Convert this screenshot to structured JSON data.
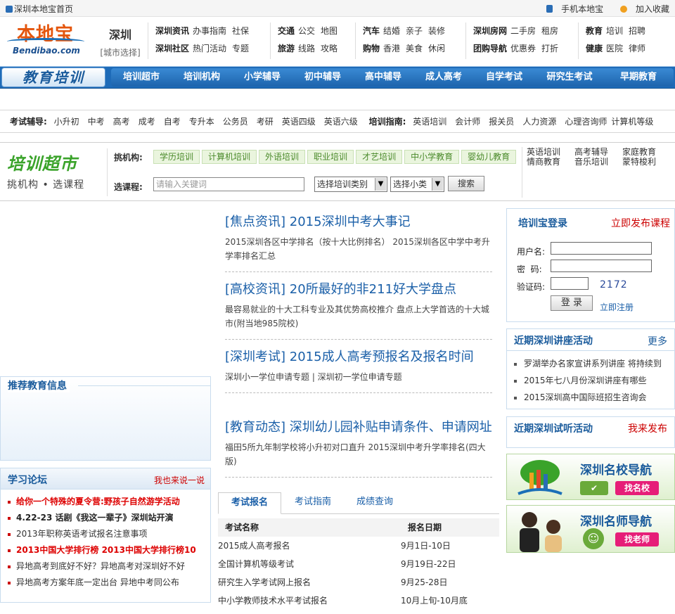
{
  "topbar": {
    "home": "深圳本地宝首页",
    "mobile": "手机本地宝",
    "favorite": "加入收藏"
  },
  "logo": {
    "cn": "本地宝",
    "en": "Bendibao.com"
  },
  "city": {
    "name": "深圳",
    "select": "[城市选择]"
  },
  "header_nav": [
    {
      "rows": [
        [
          "深圳资讯",
          "办事指南",
          "社保"
        ],
        [
          "深圳社区",
          "热门活动",
          "专题"
        ]
      ]
    },
    {
      "rows": [
        [
          "交通",
          "公交",
          "地图"
        ],
        [
          "旅游",
          "线路",
          "攻略"
        ]
      ]
    },
    {
      "rows": [
        [
          "汽车",
          "结婚",
          "亲子",
          "装修"
        ],
        [
          "购物",
          "香港",
          "美食",
          "休闲"
        ]
      ]
    },
    {
      "rows": [
        [
          "深圳房网",
          "二手房",
          "租房"
        ],
        [
          "团购导航",
          "优惠券",
          "打折"
        ]
      ]
    },
    {
      "rows": [
        [
          "教育",
          "培训",
          "招聘"
        ],
        [
          "健康",
          "医院",
          "律师"
        ]
      ]
    }
  ],
  "edu": {
    "title": "教育培训",
    "nav": [
      "培训超市",
      "培训机构",
      "小学辅导",
      "初中辅导",
      "高中辅导",
      "成人高考",
      "自学考试",
      "研究生考试",
      "早期教育"
    ]
  },
  "exam_row": {
    "label1": "考试辅导:",
    "items1": [
      "小升初",
      "中考",
      "高考",
      "成考",
      "自考",
      "专升本",
      "公务员",
      "考研",
      "英语四级",
      "英语六级"
    ],
    "label2": "培训指南:",
    "items2": [
      "英语培训",
      "会计师",
      "报关员",
      "人力资源",
      "心理咨询师",
      "计算机等级"
    ]
  },
  "market": {
    "logo_title": "培训超市",
    "logo_sub": "挑机构 • 选课程",
    "label_org": "挑机构:",
    "tags": [
      "学历培训",
      "计算机培训",
      "外语培训",
      "职业培训",
      "才艺培训",
      "中小学教育",
      "婴幼儿教育"
    ],
    "label_course": "选课程:",
    "input_placeholder": "请输入关键词",
    "select1": "选择培训类别",
    "select2": "选择小类",
    "search": "搜索",
    "links": [
      [
        "英语培训",
        "高考辅导",
        "家庭教育"
      ],
      [
        "情商教育",
        "音乐培训",
        "蒙特梭利"
      ]
    ]
  },
  "recommend": {
    "title": "推荐教育信息"
  },
  "forum": {
    "title": "学习论坛",
    "more": "我也来说一说",
    "items": [
      {
        "text": "给你一个特殊的夏令营:野孩子自然游学活动",
        "style": "red"
      },
      {
        "text": "4.22-23 话剧《我这一辈子》深圳站开演",
        "style": "bold"
      },
      {
        "text": "2013年职称英语考试报名注意事项",
        "style": ""
      },
      {
        "text": "2013中国大学排行榜  2013中国大学排行榜10",
        "style": "red"
      },
      {
        "text": "异地高考到底好不好？异地高考对深圳好不好",
        "style": ""
      },
      {
        "text": "异地高考方案年底一定出台  异地中考同公布",
        "style": ""
      }
    ]
  },
  "news": [
    {
      "title": "[焦点资讯] 2015深圳中考大事记",
      "desc": "2015深圳各区中学排名（按十大比例排名） 2015深圳各区中学中考升学率排名汇总"
    },
    {
      "title": "[高校资讯] 20所最好的非211好大学盘点",
      "desc": "最容易就业的十大工科专业及其优势高校推介  盘点上大学首选的十大城市(附当地985院校)"
    },
    {
      "title": "[深圳考试] 2015成人高考预报名及报名时间",
      "desc": "深圳小一学位申请专题 | 深圳初一学位申请专题"
    },
    {
      "title": "[教育动态] 深圳幼儿园补贴申请条件、申请网址",
      "desc": "福田5所九年制学校将小升初对口直升  2015深圳中考升学率排名(四大版)"
    }
  ],
  "exam_tabs": [
    "考试报名",
    "考试指南",
    "成绩查询"
  ],
  "exam_table": {
    "headers": [
      "考试名称",
      "报名日期"
    ],
    "rows": [
      [
        "2015成人高考报名",
        "9月1日-10日"
      ],
      [
        "全国计算机等级考试",
        "9月19日-22日"
      ],
      [
        "研究生入学考试网上报名",
        "9月25-28日"
      ],
      [
        "中小学教师技术水平考试报名",
        "10月上旬-10月底"
      ]
    ]
  },
  "login": {
    "title": "培训宝登录",
    "publish": "立即发布课程",
    "user_label": "用户名:",
    "pass_label": "密  码:",
    "code_label": "验证码:",
    "code": "2172",
    "login_btn": "登 录",
    "register": "立即注册"
  },
  "lectures": {
    "title": "近期深圳讲座活动",
    "more": "更多",
    "items": [
      "罗湖举办名家宣讲系列讲座 将持续到",
      "2015年七八月份深圳讲座有哪些",
      "2015深圳高中国际班招生咨询会"
    ]
  },
  "trial": {
    "title": "近期深圳试听活动",
    "publish": "我来发布"
  },
  "banners": [
    {
      "title": "深圳名校导航",
      "button": "找名校"
    },
    {
      "title": "深圳名师导航",
      "button": "找老师"
    }
  ],
  "colors": {
    "brand_orange": "#e4550c",
    "edu_blue": "#1e6bb8",
    "link_blue": "#1a5fa8",
    "accent_red": "#cc0000",
    "green": "#3aa32a"
  }
}
